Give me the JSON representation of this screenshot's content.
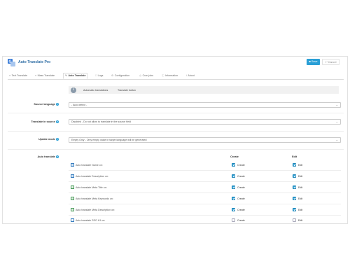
{
  "header": {
    "title": "Auto Translate Pro",
    "save_label": "Save",
    "cancel_label": "Cancel",
    "accent": "#2a9fd6"
  },
  "tabs": [
    {
      "label": "Text Translate",
      "icon": "text-icon"
    },
    {
      "label": "Mass Translate",
      "icon": "list-icon"
    },
    {
      "label": "Auto Translate",
      "icon": "pencil-icon",
      "active": true
    },
    {
      "label": "Logs",
      "icon": "doc-icon"
    },
    {
      "label": "Configuration",
      "icon": "gear-icon"
    },
    {
      "label": "Cron jobs",
      "icon": "clock-icon"
    },
    {
      "label": "Information",
      "icon": "info-icon"
    },
    {
      "label": "About",
      "icon": "info-small-icon"
    }
  ],
  "subtabs": [
    "Automatic translations",
    "Translate button"
  ],
  "form": {
    "source_language": {
      "label": "Source language",
      "value": "- Auto detect -"
    },
    "translate_in_source": {
      "label": "Translate in source",
      "value": "Disabled - Do not allow to translate in the source field"
    },
    "update_mode": {
      "label": "Update mode",
      "value": "Empty Only - Only empty value in target language will be generated"
    },
    "auto_translate": {
      "label": "Auto translate"
    }
  },
  "columns": {
    "create": "Create",
    "edit": "Edit"
  },
  "items": [
    {
      "label": "Auto translate Name on:",
      "icon": "image-icon",
      "create": true,
      "edit": true
    },
    {
      "label": "Auto translate Description on:",
      "icon": "image-icon",
      "create": true,
      "edit": true
    },
    {
      "label": "Auto translate Meta Title on:",
      "icon": "text-field-icon",
      "create": true,
      "edit": true
    },
    {
      "label": "Auto translate Meta Keywords on:",
      "icon": "text-field-icon",
      "create": true,
      "edit": true
    },
    {
      "label": "Auto translate Meta Description on:",
      "icon": "text-field-icon",
      "create": true,
      "edit": true
    },
    {
      "label": "Auto translate SEO H1 on:",
      "icon": "h1-icon",
      "create": false,
      "edit": false
    }
  ],
  "create_label": "Create",
  "edit_label": "Edit"
}
